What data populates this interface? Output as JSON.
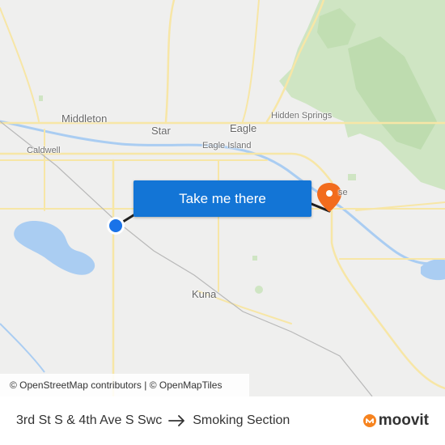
{
  "map": {
    "places": {
      "middleton": "Middleton",
      "star": "Star",
      "eagle": "Eagle",
      "hidden_springs": "Hidden Springs",
      "caldwell": "Caldwell",
      "eagle_island": "Eagle Island",
      "kuna": "Kuna",
      "boise_partial": "se"
    },
    "cta_label": "Take me there",
    "attribution": "© OpenStreetMap contributors | © OpenMapTiles"
  },
  "route": {
    "origin": "3rd St S & 4th Ave S Swc",
    "destination": "Smoking Section"
  },
  "brand": {
    "name": "moovit",
    "accent": "#f6831f",
    "pin_color": "#f26c1d",
    "origin_color": "#1a73e8",
    "button_color": "#1375d6"
  }
}
